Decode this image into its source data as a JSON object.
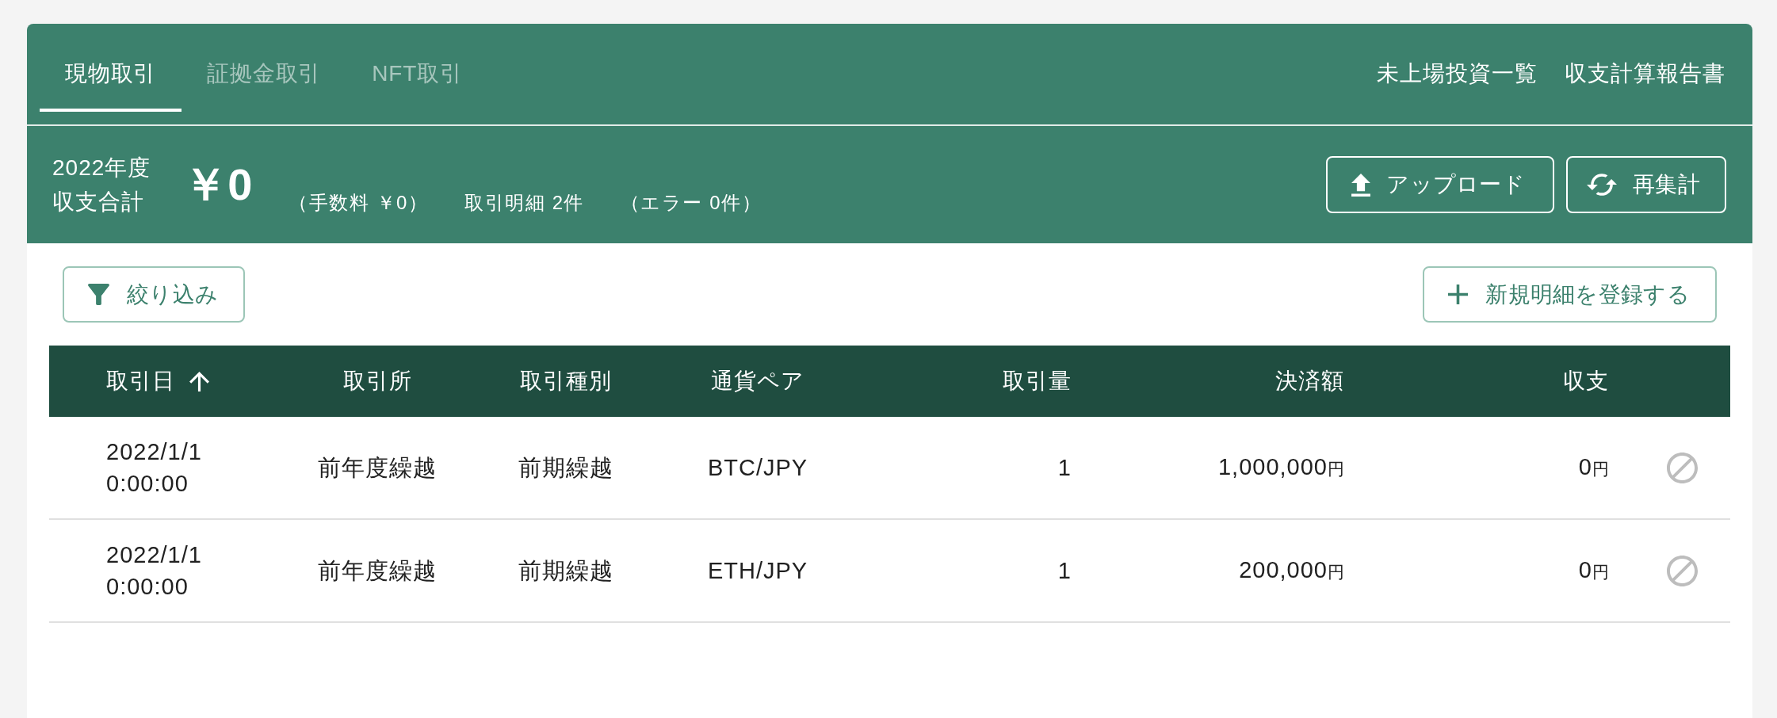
{
  "tabs": [
    {
      "label": "現物取引",
      "selected": true
    },
    {
      "label": "証拠金取引",
      "selected": false
    },
    {
      "label": "NFT取引",
      "selected": false
    }
  ],
  "header_links": [
    "未上場投資一覧",
    "収支計算報告書"
  ],
  "summary": {
    "year": "2022年度",
    "label": "収支合計",
    "total": "￥0",
    "fee": "（手数料 ￥0）",
    "count": "取引明細 2件",
    "errors": "（エラー 0件）",
    "buttons": [
      {
        "kind": "upload",
        "label": "アップロード"
      },
      {
        "kind": "recalculate",
        "label": "再集計"
      }
    ]
  },
  "toolbar": {
    "buttons": [
      {
        "kind": "filter",
        "label": "絞り込み"
      },
      {
        "kind": "add",
        "label": "新規明細を登録する"
      }
    ]
  },
  "table": {
    "columns": [
      {
        "label": "取引日",
        "sorted": true
      },
      {
        "label": "取引所",
        "sorted": false
      },
      {
        "label": "取引種別",
        "sorted": false
      },
      {
        "label": "通貨ペア",
        "sorted": false
      },
      {
        "label": "取引量",
        "sorted": false
      },
      {
        "label": "決済額",
        "sorted": false
      },
      {
        "label": "収支",
        "sorted": false
      }
    ],
    "rows": [
      {
        "date": "2022/1/1",
        "time": "0:00:00",
        "exchange": "前年度繰越",
        "type": "前期繰越",
        "pair": "BTC/JPY",
        "quantity": "1",
        "amount": "1,000,000",
        "amount_unit": "円",
        "profit": "0",
        "profit_unit": "円"
      },
      {
        "date": "2022/1/1",
        "time": "0:00:00",
        "exchange": "前年度繰越",
        "type": "前期繰越",
        "pair": "ETH/JPY",
        "quantity": "1",
        "amount": "200,000",
        "amount_unit": "円",
        "profit": "0",
        "profit_unit": "円"
      }
    ]
  }
}
